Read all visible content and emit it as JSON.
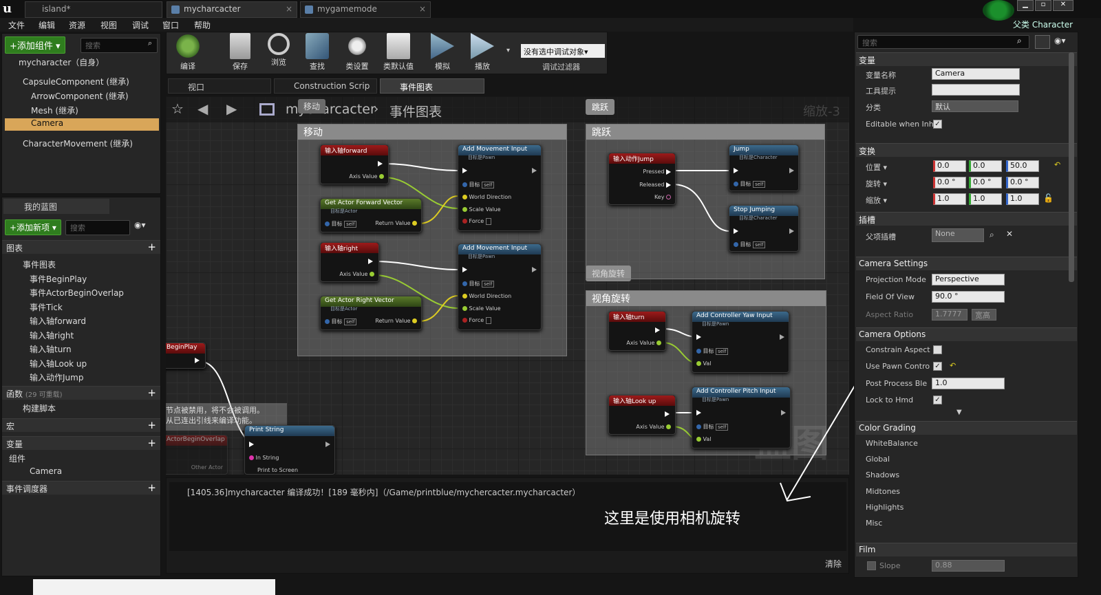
{
  "window": {
    "tabs": [
      {
        "label": "island*"
      },
      {
        "label": "mycharcacter"
      },
      {
        "label": "mygamemode"
      }
    ],
    "parent_class": "父类 Character"
  },
  "menu": [
    "文件",
    "编辑",
    "资源",
    "视图",
    "调试",
    "窗口",
    "帮助"
  ],
  "toolbar": {
    "tools": [
      "编译",
      "保存",
      "浏览",
      "查找",
      "类设置",
      "类默认值",
      "模拟",
      "播放"
    ],
    "debug_select": "没有选中调试对象▾",
    "debug_filter": "调试过滤器"
  },
  "components": {
    "add_button": "+添加组件 ▾",
    "search_placeholder": "搜索",
    "items": [
      "mycharacter（自身）",
      "CapsuleComponent (继承)",
      "ArrowComponent (继承)",
      "Mesh (继承)",
      "Camera",
      "CharacterMovement (继承)"
    ]
  },
  "mybp": {
    "tab": "我的蓝图",
    "add_button": "+添加新项 ▾",
    "search_placeholder": "搜索",
    "graphs": "图表",
    "event_graph": "事件图表",
    "events": [
      "事件BeginPlay",
      "事件ActorBeginOverlap",
      "事件Tick",
      "输入轴forward",
      "输入轴right",
      "输入轴turn",
      "输入轴Look up",
      "输入动作Jump"
    ],
    "functions": "函数",
    "functions_note": "(29 可重载)",
    "construction": "构建脚本",
    "macros": "宏",
    "variables": "变量",
    "components_cat": "组件",
    "camera_var": "Camera",
    "dispatchers": "事件调度器"
  },
  "doc_tabs": [
    "视口",
    "Construction Scrip",
    "事件图表"
  ],
  "graph": {
    "breadcrumb_bp": "mycharcacter",
    "breadcrumb_graph": "事件图表",
    "zoom": "缩放-3",
    "watermark": "蓝图",
    "comments": {
      "move": "移动",
      "jump": "跳跃",
      "rotate": "视角旋转"
    },
    "bubbles": {
      "move": "移动",
      "jump": "跳跃",
      "rotate": "视角旋转"
    },
    "nodes": {
      "fwd": "输入轴forward",
      "axis": "Axis Value",
      "add_move": "Add Movement Input",
      "target_pawn": "目标是Pawn",
      "target_actor": "目标是Actor",
      "target_char": "目标是Character",
      "target_label": "目标",
      "self": "self",
      "world_dir": "World Direction",
      "scale_value": "Scale Value",
      "force": "Force",
      "get_fwd": "Get Actor Forward Vector",
      "return_value": "Return Value",
      "right": "输入轴right",
      "get_right": "Get Actor Right Vector",
      "jump_in": "输入动作Jump",
      "pressed": "Pressed",
      "released": "Released",
      "key": "Key",
      "jump": "Jump",
      "stop_jump": "Stop Jumping",
      "turn": "输入轴turn",
      "yaw": "Add Controller Yaw Input",
      "val": "Val",
      "lookup": "输入轴Look up",
      "pitch": "Add Controller Pitch Input",
      "beginplay": "BeginPlay",
      "disabled_note1": "节点被禁用，将不会被调用。",
      "disabled_note2": "从已连出引线来编译功能。",
      "print": "Print String",
      "in_string": "In String",
      "print_screen": "Print to Screen",
      "overlap": "ActorBeginOverlap",
      "other_actor": "Other Actor"
    }
  },
  "log": {
    "line": "[1405.36]mycharcacter 编译成功！[189 毫秒内]（/Game/printblue/mychercacter.mycharcacter）",
    "annotation": "这里是使用相机旋转",
    "clear": "清除"
  },
  "details": {
    "search_placeholder": "搜索",
    "sec_var": "变量",
    "var_name_label": "变量名称",
    "var_name": "Camera",
    "tooltip_label": "工具提示",
    "tooltip": "",
    "category_label": "分类",
    "category": "默认",
    "editable_label": "Editable when Inh",
    "sec_transform": "变换",
    "location": "位置 ▾",
    "rotation": "旋转 ▾",
    "scale": "缩放 ▾",
    "loc": [
      "0.0",
      "0.0",
      "50.0"
    ],
    "rot": [
      "0.0 °",
      "0.0 °",
      "0.0 °"
    ],
    "scl": [
      "1.0",
      "1.0",
      "1.0"
    ],
    "sec_socket": "插槽",
    "parent_socket_label": "父项插槽",
    "parent_socket": "None",
    "sec_cam_settings": "Camera Settings",
    "proj_label": "Projection Mode",
    "proj": "Perspective",
    "fov_label": "Field Of View",
    "fov": "90.0 °",
    "aspect_label": "Aspect Ratio",
    "aspect": "1.7777",
    "aspect_btn": "宽高",
    "sec_cam_options": "Camera Options",
    "constrain_label": "Constrain Aspect",
    "pawn_label": "Use Pawn Contro",
    "ppb_label": "Post Process Ble",
    "ppb": "1.0",
    "lock_label": "Lock to Hmd",
    "sec_color": "Color Grading",
    "color_items": [
      "WhiteBalance",
      "Global",
      "Shadows",
      "Midtones",
      "Highlights",
      "Misc"
    ],
    "sec_film": "Film",
    "slope_label": "Slope",
    "slope": "0.88"
  }
}
